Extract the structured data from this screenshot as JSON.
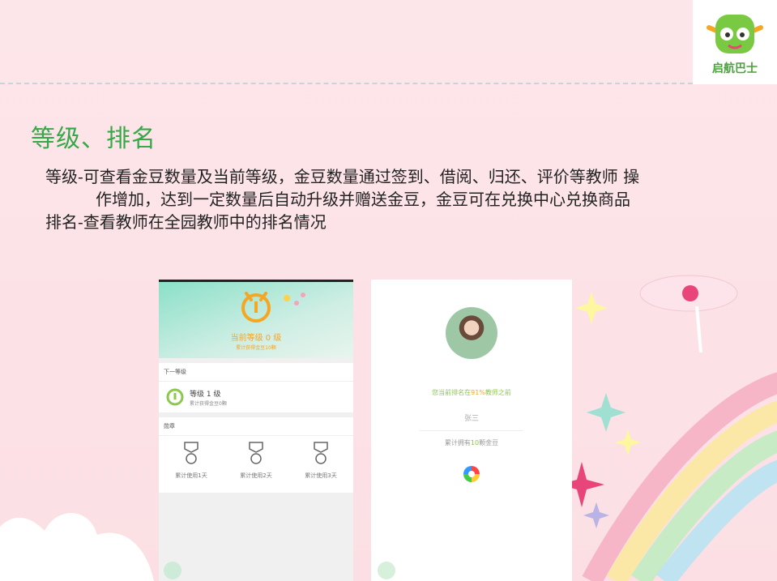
{
  "slide": {
    "logo_text": "启航巴士",
    "title": "等级、排名",
    "desc_line1": "等级-可查看金豆数量及当前等级，金豆数量通过签到、借阅、归还、评价等教师 操",
    "desc_line2": "作增加，达到一定数量后自动升级并赠送金豆，金豆可在兑换中心兑换商品",
    "desc_line3": "排名-查看教师在全园教师中的排名情况"
  },
  "level_screen": {
    "current_level": "当前等级 0 级",
    "earned": "累计获得金豆10颗",
    "next_header": "下一等级",
    "next_title": "等级 1 级",
    "next_sub": "累计获得金豆0颗",
    "medals_header": "勋章",
    "badges": [
      {
        "label": "累计使用1天"
      },
      {
        "label": "累计使用2天"
      },
      {
        "label": "累计使用3天"
      }
    ]
  },
  "rank_screen": {
    "rank_prefix": "您当前排名在",
    "rank_value": "91%",
    "rank_suffix": "教师之前",
    "name": "张三",
    "coins_prefix": "累计拥有",
    "coins_value": "10",
    "coins_suffix": "颗金豆"
  }
}
